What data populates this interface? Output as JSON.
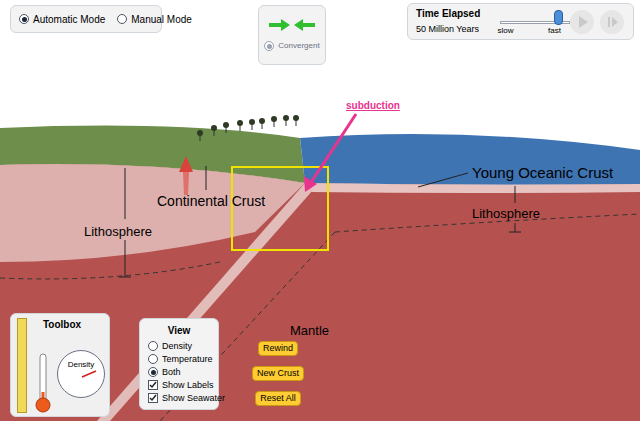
{
  "mode": [
    {
      "label": "Automatic Mode",
      "selected": true
    },
    {
      "label": "Manual Mode",
      "selected": false
    }
  ],
  "motion": {
    "label": "Convergent",
    "selected": true,
    "disabled": true
  },
  "time": {
    "title": "Time Elapsed",
    "value": "50 Million Years",
    "slow": "slow",
    "fast": "fast",
    "level": 0.9
  },
  "playback": {
    "disabled": true
  },
  "annotation": {
    "label": "subduction"
  },
  "scene_labels": {
    "continental_crust": "Continental Crust",
    "left_lithosphere": "Lithosphere",
    "oceanic_crust": "Young Oceanic Crust",
    "right_lithosphere": "Lithosphere",
    "mantle": "Mantle"
  },
  "toolbox": {
    "title": "Toolbox",
    "density_gauge": "Density"
  },
  "view": {
    "title": "View",
    "options": [
      {
        "label": "Density",
        "selected": false
      },
      {
        "label": "Temperature",
        "selected": false
      },
      {
        "label": "Both",
        "selected": true
      }
    ],
    "checks": [
      {
        "label": "Show Labels",
        "checked": true
      },
      {
        "label": "Show Seawater",
        "checked": true
      }
    ]
  },
  "buttons": [
    "Rewind",
    "New Crust",
    "Reset All"
  ]
}
